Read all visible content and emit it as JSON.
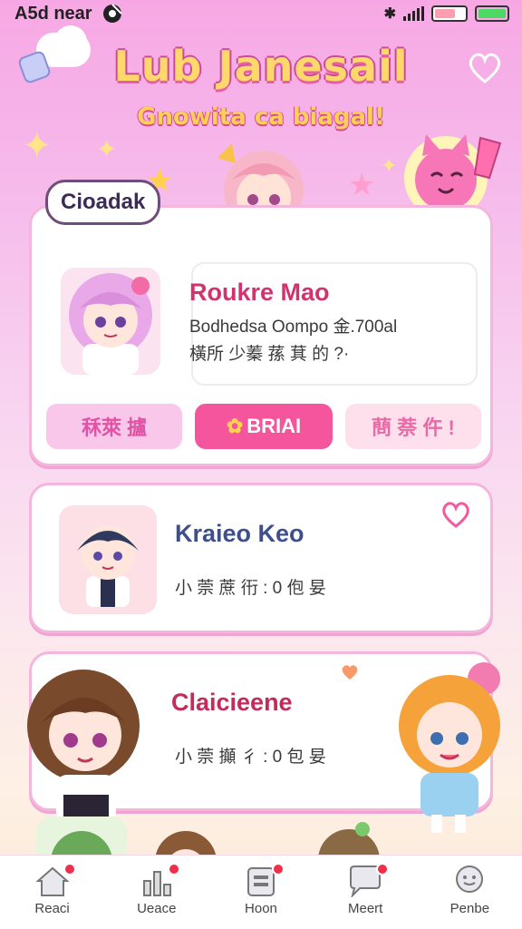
{
  "status_bar": {
    "left_text": "A5d near",
    "battery_level_1": 0.6,
    "battery_level_2": 1.0
  },
  "header": {
    "title": "Lub Janesail",
    "subtitle": "Gnowita ca biagal!"
  },
  "featured": {
    "bubble_label": "Cioadak",
    "name": "Roukre Mao",
    "desc_line1": "Bodhedsa Oompo 金.700al",
    "desc_line2": "橫所 少蓁 蓀 萁 的 ?·",
    "buttons": [
      {
        "label": "秝萊 攎"
      },
      {
        "label": "BRIAI",
        "icon": "flower-icon"
      },
      {
        "label": "蔄 萘 仵 !"
      }
    ]
  },
  "cards": [
    {
      "name": "Kraieo Keo",
      "desc": "小 萗 蔗 衎 : 0 佨 妟"
    },
    {
      "name": "Claicieene",
      "desc": "小 萗 攧 彳 : 0 包 妟"
    }
  ],
  "nav": [
    {
      "label": "Reaci",
      "icon": "home-icon"
    },
    {
      "label": "Ueace",
      "icon": "chart-icon"
    },
    {
      "label": "Hoon",
      "icon": "list-icon"
    },
    {
      "label": "Meert",
      "icon": "chat-icon"
    },
    {
      "label": "Penbe",
      "icon": "profile-icon"
    }
  ],
  "colors": {
    "accent": "#f4559d",
    "badge": "#f02e4a",
    "name_pink": "#d2336f",
    "name_blue": "#3e4f8c"
  }
}
